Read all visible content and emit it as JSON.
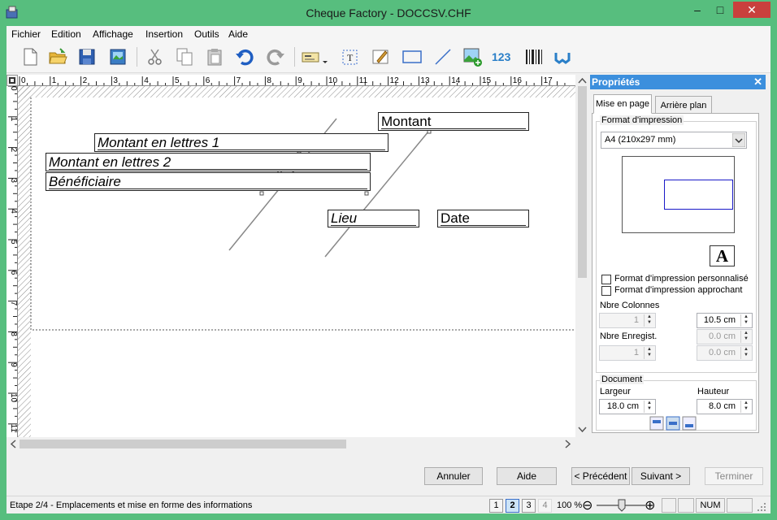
{
  "window": {
    "title": "Cheque Factory - DOCCSV.CHF",
    "minimize": "–",
    "maximize": "□",
    "close": "✕"
  },
  "menu": [
    "Fichier",
    "Edition",
    "Affichage",
    "Insertion",
    "Outils",
    "Aide"
  ],
  "toolbar": {
    "icons": [
      "new-document-icon",
      "open-folder-icon",
      "save-icon",
      "save-image-icon",
      "cut-icon",
      "copy-icon",
      "paste-icon",
      "undo-icon",
      "redo-icon",
      "cheque-icon",
      "text-field-icon",
      "edit-image-icon",
      "rectangle-icon",
      "line-icon",
      "insert-image-icon",
      "numbering-icon",
      "barcode-icon",
      "logo-icon"
    ],
    "numbering_label": "123"
  },
  "ruler": {
    "h_ticks": [
      "0",
      "1",
      "2",
      "3",
      "4",
      "5",
      "6",
      "7",
      "8",
      "9",
      "10",
      "11",
      "12",
      "13",
      "14",
      "15",
      "16",
      "17"
    ],
    "v_ticks": [
      "0",
      "1",
      "2",
      "3",
      "4",
      "5",
      "6",
      "7",
      "8",
      "9",
      "10",
      "11"
    ]
  },
  "canvas": {
    "fields": {
      "montant": "Montant",
      "lettres1": "Montant en lettres 1",
      "lettres2": "Montant en lettres 2",
      "beneficiaire": "Bénéficiaire",
      "lieu": "Lieu",
      "date": "Date"
    }
  },
  "properties": {
    "header": "Propriétés",
    "tabs": [
      "Mise en page",
      "Arrière plan"
    ],
    "format_group": "Format d'impression",
    "format_select": "A4 (210x297 mm)",
    "orientation_glyph": "A",
    "checkboxes": [
      "Format d'impression personnalisé",
      "Format d'impression approchant"
    ],
    "nbre_colonnes_label": "Nbre Colonnes",
    "nbre_colonnes_value": "1",
    "nbre_enreg_label": "Nbre Enregist.",
    "nbre_enreg_value": "1",
    "right_spins": [
      "10.5 cm",
      "0.0 cm",
      "0.0 cm"
    ],
    "document_group": "Document",
    "largeur_label": "Largeur",
    "largeur_value": "18.0 cm",
    "hauteur_label": "Hauteur",
    "hauteur_value": "8.0 cm"
  },
  "buttons": {
    "annuler": "Annuler",
    "aide": "Aide",
    "precedent": "< Précédent",
    "suivant": "Suivant >",
    "terminer": "Terminer"
  },
  "status": {
    "text": "Etape 2/4 - Emplacements et mise en forme des informations",
    "pages": [
      "1",
      "2",
      "3",
      "4"
    ],
    "current_page": 2,
    "zoom": "100 %",
    "zoom_minus": "⊖",
    "zoom_plus": "⊕",
    "num": "NUM"
  },
  "colors": {
    "title_bar": "#57be7e",
    "accent": "#3c8fdd",
    "close_button": "#c9403d"
  }
}
